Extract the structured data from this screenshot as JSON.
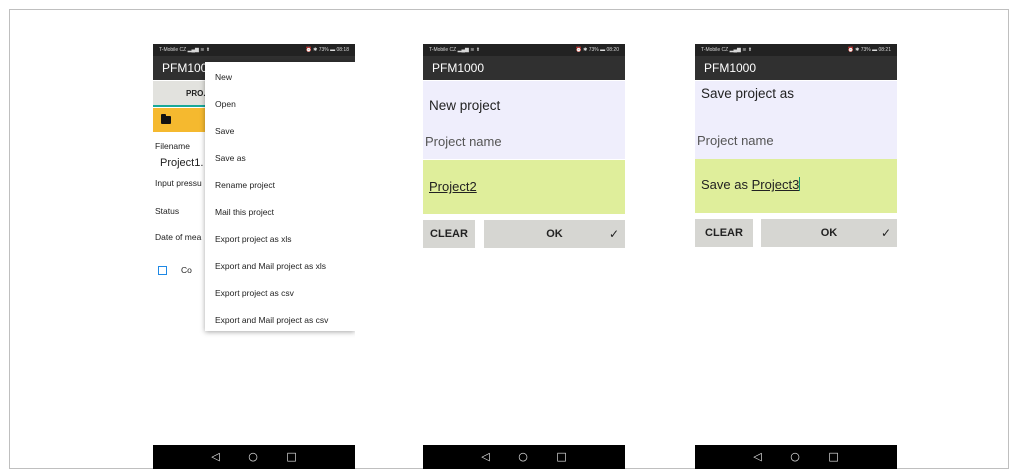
{
  "status": {
    "carrier": "T-Mobile CZ",
    "signal": "▂▄▆ ≋ ⬆",
    "right1": "⏰ ✱ 73% ▬ 08:18",
    "right2": "⏰ ✱ 73% ▬ 08:20",
    "right3": "⏰ ✱ 73% ▬ 08:21"
  },
  "app": {
    "title1": "PFM100",
    "title": "PFM1000"
  },
  "phone1": {
    "tab": "PRO.",
    "filename_label": "Filename",
    "filename_value": "Project1.",
    "input_label": "Input pressu",
    "status_label": "Status",
    "date_label": "Date of mea",
    "checkbox_label": "Co",
    "menu": [
      "New",
      "Open",
      "Save",
      "Save as",
      "Rename project",
      "Mail this project",
      "Export project as xls",
      "Export and Mail project as xls",
      "Export project as csv",
      "Export and Mail project as csv"
    ]
  },
  "phone2": {
    "heading": "New project",
    "name_label": "Project name",
    "name_value": "Project2",
    "clear": "CLEAR",
    "ok": "OK"
  },
  "phone3": {
    "heading": "Save project as",
    "name_label": "Project name",
    "name_prefix": "Save as",
    "name_value": "Project3",
    "clear": "CLEAR",
    "ok": "OK"
  },
  "icons": {
    "back": "back-icon",
    "home": "home-icon",
    "recents": "recents-icon",
    "check": "check-icon",
    "folder": "folder-icon"
  },
  "colors": {
    "accent_orange": "#f5b92f",
    "title_box": "#efeefc",
    "name_box": "#dfee9b",
    "teal": "#18a999"
  }
}
